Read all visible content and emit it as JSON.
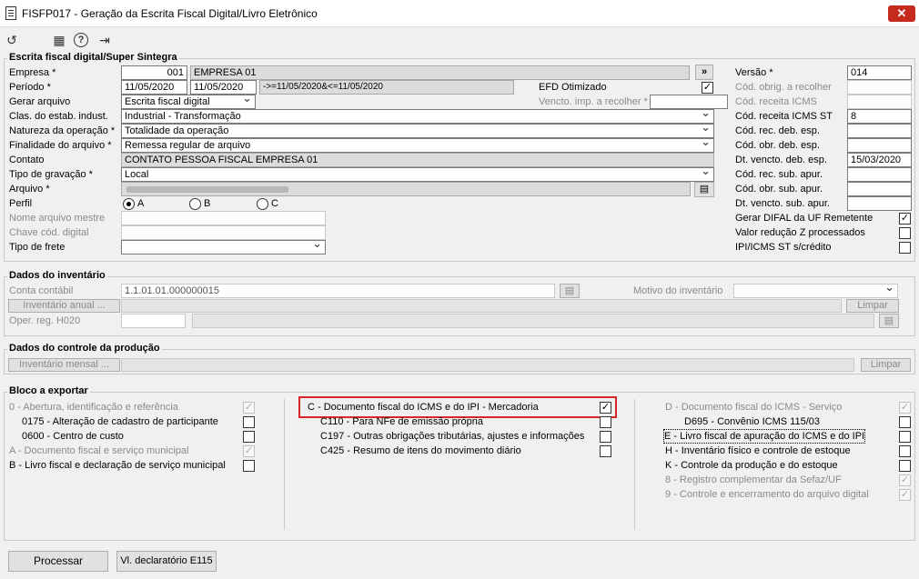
{
  "window": {
    "title": "FISFP017 - Geração da Escrita Fiscal Digital/Livro Eletrônico",
    "close": "✕"
  },
  "toolbar": {
    "refresh_icon": "↺",
    "calendar_icon": "▦",
    "help_icon": "?",
    "exit_icon": "⇥"
  },
  "efd": {
    "group_title": "Escrita fiscal digital/Super Sintegra",
    "empresa_label": "Empresa *",
    "empresa_code": "001",
    "empresa_name": "EMPRESA 01",
    "empresa_btn": "»",
    "periodo_label": "Período *",
    "periodo_ini": "11/05/2020",
    "periodo_fim": "11/05/2020",
    "periodo_expr": "->=11/05/2020&<=11/05/2020",
    "efd_otimizado_label": "EFD Otimizado",
    "efd_otimizado_check": "✓",
    "gerar_label": "Gerar arquivo",
    "gerar_value": "Escrita fiscal digital",
    "vencto_label": "Vencto. imp. a recolher *",
    "clas_label": "Clas. do estab. indust.",
    "clas_value": "Industrial - Transformação",
    "natureza_label": "Natureza da operação *",
    "natureza_value": "Totalidade da operação",
    "finalidade_label": "Finalidade do arquivo *",
    "finalidade_value": "Remessa regular de arquivo",
    "contato_label": "Contato",
    "contato_value": "CONTATO PESSOA FISCAL EMPRESA 01",
    "tipo_grav_label": "Tipo de gravação *",
    "tipo_grav_value": "Local",
    "arquivo_label": "Arquivo *",
    "arquivo_btn": "▤",
    "perfil_label": "Perfil",
    "perfil_a": "A",
    "perfil_b": "B",
    "perfil_c": "C",
    "nome_mestre_label": "Nome arquivo mestre",
    "chave_label": "Chave cód. digital",
    "frete_label": "Tipo de frete",
    "versao_label": "Versão *",
    "versao_value": "014",
    "cod_obrig_label": "Cód. obrig. a recolher",
    "cod_rec_icms_label": "Cód. receita ICMS",
    "cod_rec_icms_st_label": "Cód. receita ICMS ST",
    "cod_rec_icms_st_value": "8",
    "cod_rec_deb_label": "Cód. rec. deb. esp.",
    "cod_obr_deb_label": "Cód. obr. deb. esp.",
    "dt_vencto_label": "Dt. vencto. deb. esp.",
    "dt_vencto_value": "15/03/2020",
    "cod_rec_sub_label": "Cód. rec. sub. apur.",
    "cod_obr_sub_label": "Cód. obr. sub. apur.",
    "dt_vencto_sub_label": "Dt. vencto. sub. apur.",
    "difal_label": "Gerar DIFAL da UF Remetente",
    "difal_check": "✓",
    "valor_z_label": "Valor redução Z processados",
    "ipi_label": "IPI/ICMS ST s/crédito"
  },
  "inventario": {
    "group_title": "Dados do inventário",
    "conta_label": "Conta contábil",
    "conta_value": "1.1.01.01.000000015",
    "motivo_label": "Motivo do inventário",
    "anual_btn": "Inventário anual ...",
    "limpar": "Limpar",
    "oper_label": "Oper. reg. H020"
  },
  "producao": {
    "group_title": "Dados do controle da produção",
    "mensal_btn": "Inventário mensal ...",
    "limpar": "Limpar"
  },
  "bloco": {
    "group_title": "Bloco a exportar",
    "col1": [
      {
        "label": "0 - Abertura, identificação e referência",
        "check": "✓"
      },
      {
        "label": "0175 - Alteração de cadastro de participante",
        "check": ""
      },
      {
        "label": "0600 - Centro de custo",
        "check": ""
      },
      {
        "label": "A - Documento fiscal e serviço municipal",
        "check": "✓"
      },
      {
        "label": "B - Livro fiscal e declaração de serviço municipal",
        "check": ""
      }
    ],
    "col2": [
      {
        "label": "C - Documento fiscal do ICMS e do IPI - Mercadoria",
        "check": "✓"
      },
      {
        "label": "C110 - Para NFe de emissão própria",
        "check": ""
      },
      {
        "label": "C197 - Outras obrigações tributárias, ajustes e informações",
        "check": ""
      },
      {
        "label": "C425 - Resumo de itens do movimento diário",
        "check": ""
      }
    ],
    "col3": [
      {
        "label": "D - Documento fiscal do ICMS - Serviço",
        "check": "✓"
      },
      {
        "label": "D695 - Convênio ICMS 115/03",
        "check": ""
      },
      {
        "label": "E - Livro fiscal de apuração do ICMS e do IPI",
        "check": ""
      },
      {
        "label": "H - Inventário físico e controle de estoque",
        "check": ""
      },
      {
        "label": "K - Controle da produção e do estoque",
        "check": ""
      },
      {
        "label": "8 - Registro complementar da Sefaz/UF",
        "check": "✓"
      },
      {
        "label": "9 - Controle e encerramento do arquivo digital",
        "check": "✓"
      }
    ]
  },
  "footer": {
    "processar": "Processar",
    "vl_declaratorio": "Vl. declaratório E115"
  },
  "colors": {
    "highlight": "#d9262a",
    "close": "#c42b1c"
  }
}
